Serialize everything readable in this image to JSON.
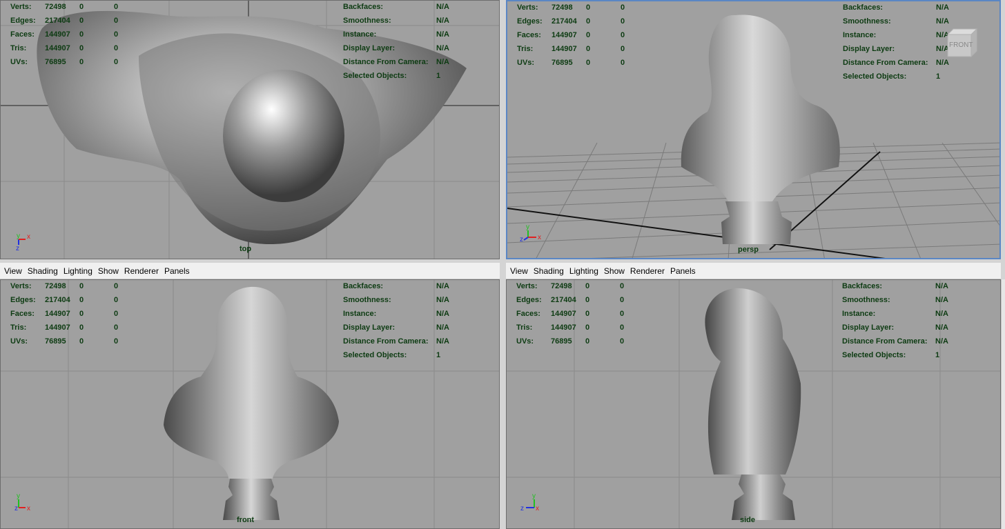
{
  "stats": {
    "labels": [
      "Verts:",
      "Edges:",
      "Faces:",
      "Tris:",
      "UVs:"
    ],
    "values": [
      [
        "72498",
        "0",
        "0"
      ],
      [
        "217404",
        "0",
        "0"
      ],
      [
        "144907",
        "0",
        "0"
      ],
      [
        "144907",
        "0",
        "0"
      ],
      [
        "76895",
        "0",
        "0"
      ]
    ]
  },
  "props": {
    "labels": [
      "Backfaces:",
      "Smoothness:",
      "Instance:",
      "Display Layer:",
      "Distance From Camera:",
      "Selected Objects:"
    ],
    "values": [
      "N/A",
      "N/A",
      "N/A",
      "N/A",
      "N/A",
      "1"
    ]
  },
  "viewports": {
    "top": {
      "camera": "top"
    },
    "persp": {
      "camera": "persp",
      "viewcube_label": "FRONT"
    },
    "front": {
      "camera": "front"
    },
    "side": {
      "camera": "side"
    }
  },
  "menubar": [
    "View",
    "Shading",
    "Lighting",
    "Show",
    "Renderer",
    "Panels"
  ],
  "axes": {
    "x": "x",
    "y": "y",
    "z": "z"
  },
  "colors": {
    "viewport_bg": "#a0a0a0",
    "hud_text": "#0d3b12",
    "active_border": "#5a86c4",
    "axis_x": "#e02020",
    "axis_y": "#20c020",
    "axis_z": "#2030e0"
  }
}
